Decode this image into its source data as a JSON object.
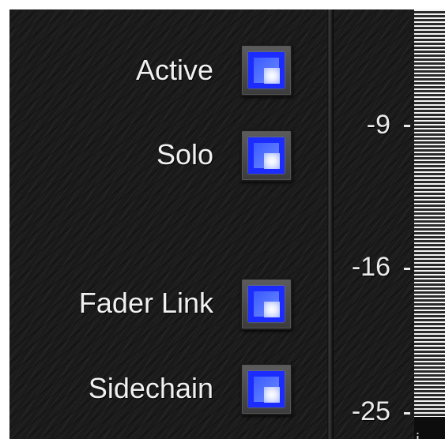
{
  "controls": [
    {
      "label": "Active",
      "state": "on"
    },
    {
      "label": "Solo",
      "state": "on"
    },
    {
      "label": "Fader Link",
      "state": "on"
    },
    {
      "label": "Sidechain",
      "state": "on"
    }
  ],
  "meter": {
    "scale_labels": [
      "-9",
      "-16",
      "-25"
    ],
    "cut_label": "i"
  },
  "colors": {
    "panel_bg": "#1a1a1a",
    "led_on": "#1c2cff",
    "led_glow": "#ffffff",
    "text": "#f0f0f0"
  }
}
